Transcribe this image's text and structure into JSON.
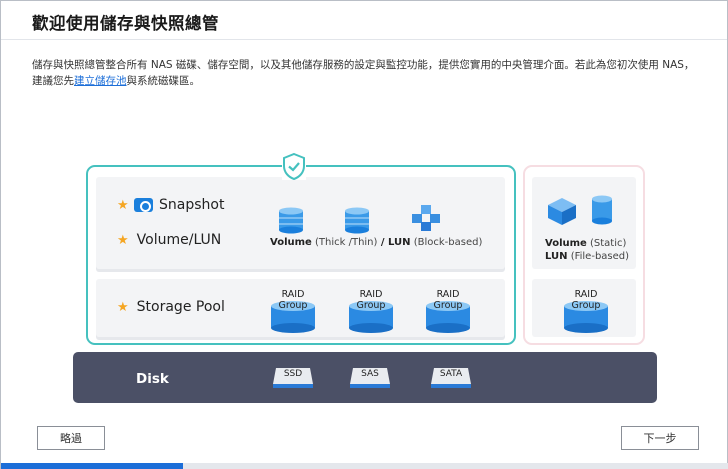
{
  "header": {
    "title": "歡迎使用儲存與快照總管"
  },
  "intro": {
    "text_before_link": "儲存與快照總管整合所有 NAS 磁碟、儲存空間，以及其他儲存服務的設定與監控功能，提供您實用的中央管理介面。若此為您初次使用 NAS，建議您先",
    "link_text": "建立儲存池",
    "text_after_link": "與系統磁碟區。"
  },
  "diagram": {
    "rows": {
      "snapshot": "Snapshot",
      "volume_lun": "Volume/LUN",
      "storage_pool": "Storage Pool"
    },
    "block_caption": {
      "volume": "Volume",
      "volume_types": " (Thick /Thin)",
      "lun": " / LUN",
      "lun_type": " (Block-based)"
    },
    "static_caption": {
      "volume": "Volume",
      "volume_type": " (Static)",
      "lun": "LUN",
      "lun_type": " (File-based)"
    },
    "raid_line1": "RAID",
    "raid_line2": "Group",
    "disk_label": "Disk",
    "drives": [
      "SSD",
      "SAS",
      "SATA"
    ]
  },
  "colors": {
    "accent_teal": "#45c1bf",
    "accent_blue": "#1c6ed8",
    "disk_bar": "#4b5066",
    "star": "#f5a623"
  },
  "icons": {
    "shield": "shield-icon",
    "snapshot": "camera-icon",
    "volume": "cylinder-icon",
    "lun": "cubes-icon"
  },
  "footer": {
    "skip_label": "略過",
    "next_label": "下一步",
    "progress_fraction": 0.25
  }
}
